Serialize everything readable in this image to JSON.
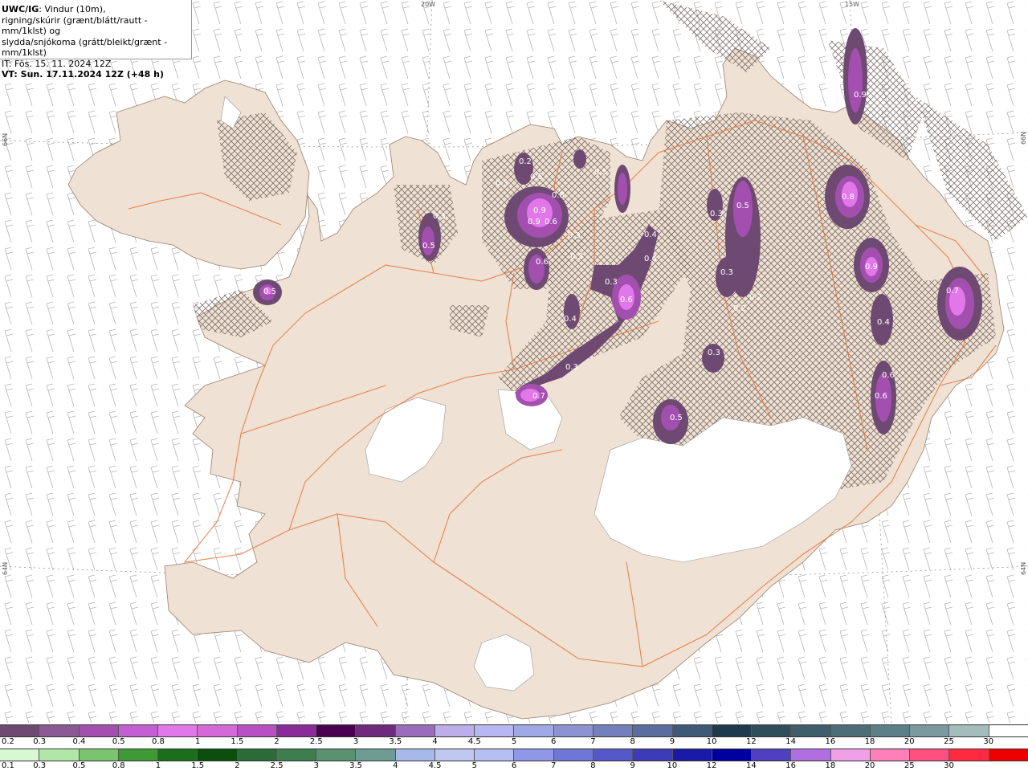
{
  "header": {
    "model": "UWC/IG",
    "line1_rest": ": Vindur (10m),",
    "line2": "rigning/skúrir (grænt/blátt/rautt - mm/1klst) og",
    "line3": "slydda/snjókoma (grátt/bleikt/grænt - mm/1klst)",
    "line4": "IT: Fös. 15. 11. 2024 12Z",
    "line5": "VT: Sun. 17.11.2024 12Z (+48 h)"
  },
  "coords": {
    "top_20w": "20W",
    "top_15w": "15W",
    "left_66n": "66N",
    "right_66n": "66N",
    "left_64n": "64N",
    "right_64n": "64N"
  },
  "colors": {
    "land": "#efe1d3",
    "roads": "#e8743a",
    "glacier": "#ffffff",
    "sea": "#ffffff",
    "precip_dark": "#6e4a73",
    "precip_mid": "#a34fb0",
    "precip_light": "#e277ea"
  },
  "precip_values": [
    "0.5",
    "0.3",
    "0.5",
    "0.2",
    "0.5",
    "0.3",
    "0.8",
    "0.9",
    "0.6",
    "0.9",
    "0.3",
    "0.3",
    "0.6",
    "0.4",
    "0.4",
    "0.3",
    "0.6",
    "0.4",
    "0.3",
    "0.7",
    "0.5",
    "0.3",
    "0.5",
    "0.3",
    "0.2",
    "0.2",
    "0.9",
    "0.8",
    "0.9",
    "0.4",
    "0.6",
    "0.6",
    "0.7",
    "0.5",
    "0.3"
  ],
  "legend": {
    "snow_labels": [
      "0.2",
      "0.3",
      "0.4",
      "0.5",
      "0.8",
      "1",
      "1.5",
      "2",
      "2.5",
      "3",
      "3.5",
      "4",
      "4.5",
      "5",
      "6",
      "7",
      "8",
      "9",
      "10",
      "12",
      "14",
      "16",
      "18",
      "20",
      "25",
      "30"
    ],
    "snow_colors": [
      "#6e4a73",
      "#8a5a94",
      "#a34fb0",
      "#c25fd2",
      "#e277ea",
      "#d36ad8",
      "#b84fc3",
      "#8a2c97",
      "#4a0050",
      "#6e2a7d",
      "#9a6dba",
      "#bcaee8",
      "#b7b7f1",
      "#9fa9e6",
      "#8d93d1",
      "#7480bb",
      "#5b6d9e",
      "#3f5a76",
      "#1f3a4a",
      "#2f4e5c",
      "#3f5e6c",
      "#4d6e78",
      "#5d8088",
      "#7a9aa0",
      "#a4bcbc",
      "#ffffff"
    ],
    "rain_labels": [
      "0.1",
      "0.3",
      "0.5",
      "0.8",
      "1",
      "1.5",
      "2",
      "2.5",
      "3",
      "3.5",
      "4",
      "4.5",
      "5",
      "6",
      "7",
      "8",
      "9",
      "10",
      "12",
      "14",
      "16",
      "18",
      "20",
      "25",
      "30"
    ],
    "rain_colors": [
      "#d8f7d3",
      "#b0e6a6",
      "#7ac46e",
      "#3f9a35",
      "#1b6e1c",
      "#0c4e0e",
      "#2a6b38",
      "#3e7d4e",
      "#5a9170",
      "#6c9c92",
      "#a7b8ea",
      "#c0c8f0",
      "#b6bff2",
      "#8f97e6",
      "#6e77d6",
      "#5558c8",
      "#3c3cb8",
      "#1a1aa8",
      "#0000a0",
      "#5040c0",
      "#b16ee0",
      "#f0a0e6",
      "#ff7fb8",
      "#ff5080",
      "#ff2a40",
      "#ee0000"
    ]
  }
}
